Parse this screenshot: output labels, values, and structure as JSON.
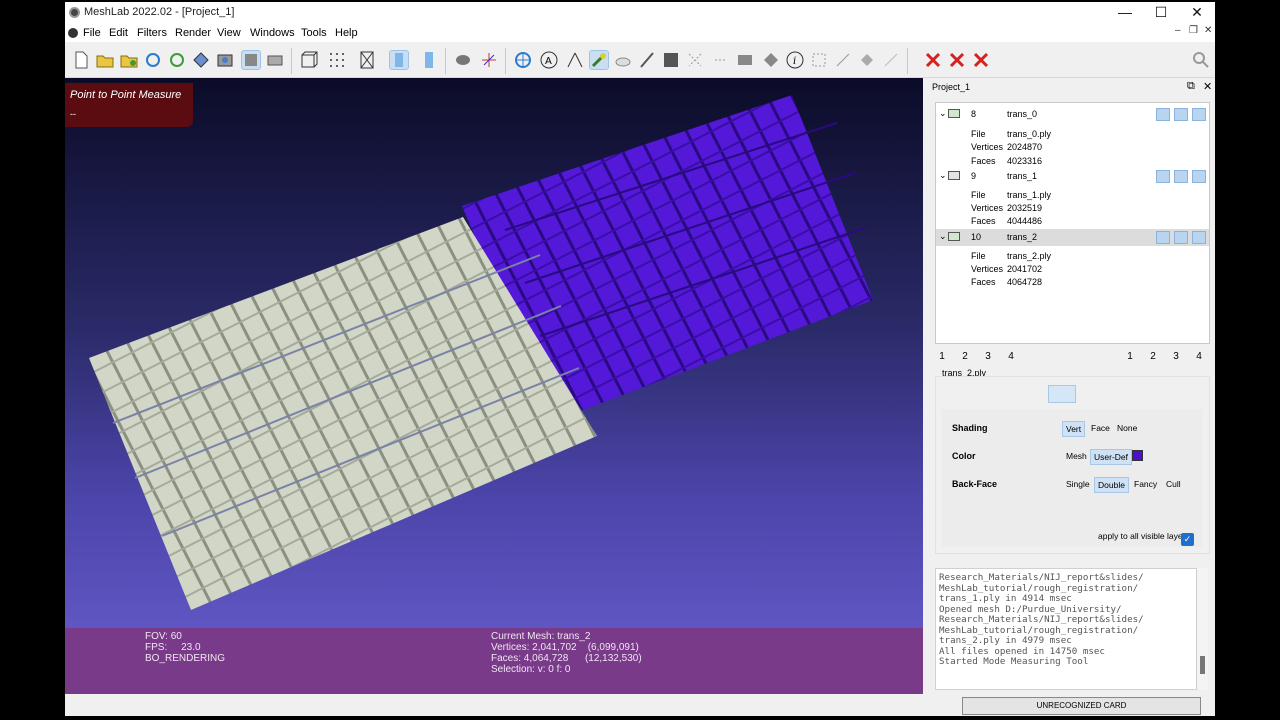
{
  "window": {
    "title": "MeshLab 2022.02 - [Project_1]",
    "controls": {
      "minimize": "—",
      "maximize": "☐",
      "close": "✕"
    }
  },
  "menubar": {
    "items": [
      "File",
      "Edit",
      "Filters",
      "Render",
      "View",
      "Windows",
      "Tools",
      "Help"
    ],
    "mdi_controls": {
      "minimize": "–",
      "restore": "❐",
      "close": "✕"
    }
  },
  "viewport": {
    "mode_title": "Point to Point Measure",
    "mode_subtitle": "--",
    "mesh_colors": {
      "background_top": "#0b0b28",
      "background_bottom": "#5f56c2",
      "mesh_light": "#d4d8c8",
      "mesh_user": "#5218d8"
    }
  },
  "infobar": {
    "fov": "FOV: 60",
    "fps": "FPS:     23.0",
    "rendering": "BO_RENDERING",
    "current_mesh": "Current Mesh: trans_2",
    "vertices": "Vertices: 2,041,702    (6,099,091)",
    "faces": "Faces: 4,064,728      (12,132,530)",
    "selection": "Selection: v: 0 f: 0"
  },
  "dock": {
    "title": "Project_1",
    "float_icon": "⧉",
    "close_icon": "✕",
    "layers": [
      {
        "index": "8",
        "name": "trans_0",
        "file_label": "File",
        "file": "trans_0.ply",
        "vertices_label": "Vertices",
        "vertices": "2024870",
        "faces_label": "Faces",
        "faces": "4023316"
      },
      {
        "index": "9",
        "name": "trans_1",
        "file_label": "File",
        "file": "trans_1.ply",
        "vertices_label": "Vertices",
        "vertices": "2032519",
        "faces_label": "Faces",
        "faces": "4044486"
      },
      {
        "index": "10",
        "name": "trans_2",
        "file_label": "File",
        "file": "trans_2.ply",
        "vertices_label": "Vertices",
        "vertices": "2041702",
        "faces_label": "Faces",
        "faces": "4064728"
      }
    ],
    "pages_left": [
      "1",
      "2",
      "3",
      "4"
    ],
    "pages_right": [
      "1",
      "2",
      "3",
      "4"
    ],
    "current_file": "trans_2.ply",
    "render": {
      "shading_label": "Shading",
      "shading_options": [
        "Vert",
        "Face",
        "None"
      ],
      "shading_selected": "Vert",
      "color_label": "Color",
      "color_options": [
        "Mesh",
        "User-Def"
      ],
      "color_selected": "User-Def",
      "user_color": "#4b12c8",
      "backface_label": "Back-Face",
      "backface_options": [
        "Single",
        "Double",
        "Fancy",
        "Cull"
      ],
      "backface_selected": "Double",
      "apply_all": "apply to all visible layers",
      "apply_checked": "✓"
    },
    "log": [
      "Research_Materials/NIJ_report&slides/",
      "MeshLab_tutorial/rough_registration/",
      "trans_1.ply in 4914 msec",
      "Opened mesh D:/Purdue_University/",
      "Research_Materials/NIJ_report&slides/",
      "MeshLab_tutorial/rough_registration/",
      "trans_2.ply in 4979 msec",
      "All files opened in 14750 msec",
      "Started Mode Measuring Tool"
    ]
  },
  "statusbar": {
    "card": "UNRECOGNIZED CARD"
  }
}
